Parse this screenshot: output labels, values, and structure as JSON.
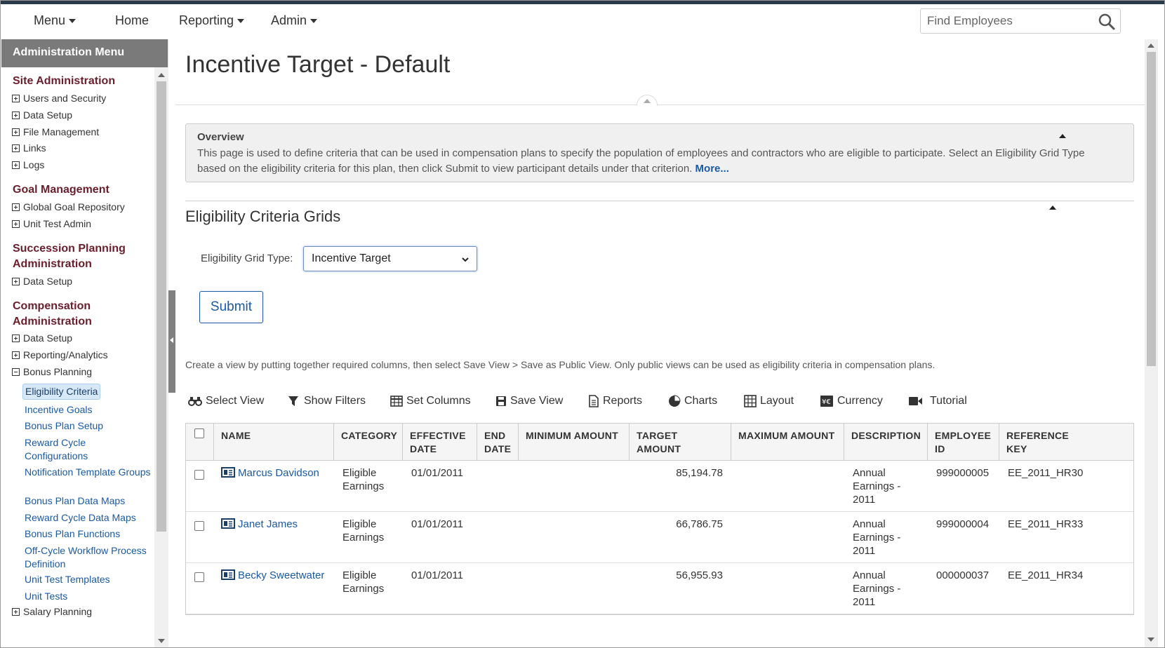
{
  "topnav": {
    "menu": "Menu",
    "home": "Home",
    "reporting": "Reporting",
    "admin": "Admin",
    "search_placeholder": "Find Employees"
  },
  "sidebar": {
    "header": "Administration Menu",
    "site_admin": {
      "title": "Site Administration",
      "items": [
        "Users and Security",
        "Data Setup",
        "File Management",
        "Links",
        "Logs"
      ]
    },
    "goal_mgmt": {
      "title": "Goal Management",
      "items": [
        "Global Goal Repository",
        "Unit Test Admin"
      ]
    },
    "succession": {
      "title_line1": "Succession Planning",
      "title_line2": "Administration",
      "items": [
        "Data Setup"
      ]
    },
    "compensation": {
      "title_line1": "Compensation",
      "title_line2": "Administration",
      "items": [
        "Data Setup",
        "Reporting/Analytics",
        "Bonus Planning"
      ],
      "bonus_links": [
        "Eligibility Criteria",
        "Incentive Goals",
        "Bonus Plan Setup",
        "Reward Cycle Configurations",
        "Notification Template Groups",
        "Bonus Plan Data Maps",
        "Reward Cycle Data Maps",
        "Bonus Plan Functions",
        "Off-Cycle Workflow Process Definition",
        "Unit Test Templates",
        "Unit Tests"
      ],
      "next_item": "Salary Planning"
    }
  },
  "main": {
    "page_title": "Incentive Target - Default",
    "overview": {
      "title": "Overview",
      "text": "This page is used to define criteria that can be used in compensation plans to specify the population of employees and contractors who are eligible to participate. Select an Eligibility Grid Type based on the eligibility criteria for this plan, then click Submit to view participant details under that criterion.",
      "more": "More..."
    },
    "section_title": "Eligibility Criteria Grids",
    "grid_type_label": "Eligibility Grid Type:",
    "grid_type_value": "Incentive Target",
    "submit": "Submit",
    "help_text": "Create a view by putting together required columns, then select Save View > Save as Public View. Only public views can be used as eligibility criteria in compensation plans.",
    "toolbar": {
      "select_view": "Select View",
      "show_filters": "Show Filters",
      "set_columns": "Set Columns",
      "save_view": "Save View",
      "reports": "Reports",
      "charts": "Charts",
      "layout": "Layout",
      "currency": "Currency",
      "tutorial": "Tutorial"
    },
    "table": {
      "headers": {
        "name": "NAME",
        "category": "CATEGORY",
        "effective_date_1": "EFFECTIVE",
        "effective_date_2": "DATE",
        "end_date_1": "END",
        "end_date_2": "DATE",
        "minimum_amount": "MINIMUM AMOUNT",
        "target_amount": "TARGET AMOUNT",
        "maximum_amount": "MAXIMUM AMOUNT",
        "description": "DESCRIPTION",
        "employee_id_1": "EMPLOYEE",
        "employee_id_2": "ID",
        "reference_key_1": "REFERENCE",
        "reference_key_2": "KEY"
      },
      "rows": [
        {
          "name": "Marcus Davidson",
          "category_1": "Eligible",
          "category_2": "Earnings",
          "effective_date": "01/01/2011",
          "end_date": "",
          "minimum_amount": "",
          "target_amount": "85,194.78",
          "maximum_amount": "",
          "description_1": "Annual",
          "description_2": "Earnings -",
          "description_3": "2011",
          "employee_id": "999000005",
          "reference_key": "EE_2011_HR30"
        },
        {
          "name": "Janet James",
          "category_1": "Eligible",
          "category_2": "Earnings",
          "effective_date": "01/01/2011",
          "end_date": "",
          "minimum_amount": "",
          "target_amount": "66,786.75",
          "maximum_amount": "",
          "description_1": "Annual",
          "description_2": "Earnings -",
          "description_3": "2011",
          "employee_id": "999000004",
          "reference_key": "EE_2011_HR33"
        },
        {
          "name": "Becky Sweetwater",
          "category_1": "Eligible",
          "category_2": "Earnings",
          "effective_date": "01/01/2011",
          "end_date": "",
          "minimum_amount": "",
          "target_amount": "56,955.93",
          "maximum_amount": "",
          "description_1": "Annual",
          "description_2": "Earnings -",
          "description_3": "2011",
          "employee_id": "000000037",
          "reference_key": "EE_2011_HR34"
        }
      ]
    }
  },
  "colors": {
    "accent": "#1a5aa5",
    "section_title": "#6b1e2b",
    "sidebar_header": "#7a7a7a"
  }
}
